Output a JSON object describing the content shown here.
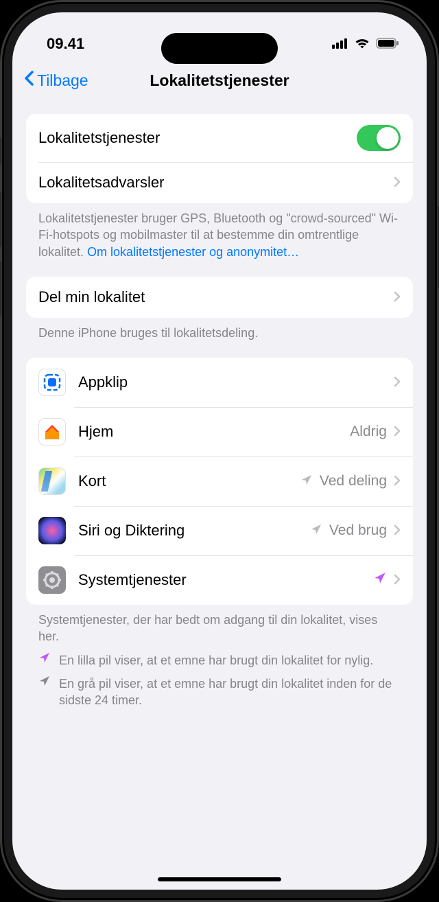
{
  "status": {
    "time": "09.41"
  },
  "nav": {
    "back": "Tilbage",
    "title": "Lokalitetstjenester"
  },
  "section1": {
    "toggle_label": "Lokalitetstjenester",
    "alerts_label": "Lokalitetsadvarsler",
    "footer_text": "Lokalitetstjenester bruger GPS, Bluetooth og \"crowd-sourced\" Wi-Fi-hotspots og mobilmaster til at bestemme din omtrentlige lokalitet. ",
    "footer_link": "Om lokalitetstjenester og anonymitet…"
  },
  "section2": {
    "share_label": "Del min lokalitet",
    "footer": "Denne iPhone bruges til lokalitetsdeling."
  },
  "apps": [
    {
      "label": "Appklip",
      "detail": "",
      "arrow": ""
    },
    {
      "label": "Hjem",
      "detail": "Aldrig",
      "arrow": ""
    },
    {
      "label": "Kort",
      "detail": "Ved deling",
      "arrow": "gray"
    },
    {
      "label": "Siri og Diktering",
      "detail": "Ved brug",
      "arrow": "gray"
    },
    {
      "label": "Systemtjenester",
      "detail": "",
      "arrow": "purple"
    }
  ],
  "apps_footer": "Systemtjenester, der har bedt om adgang til din lokalitet, vises her.",
  "legend": {
    "purple": "En lilla pil viser, at et emne har brugt din lokalitet for nylig.",
    "gray": "En grå pil viser, at et emne har brugt din lokalitet inden for de sidste 24 timer."
  }
}
